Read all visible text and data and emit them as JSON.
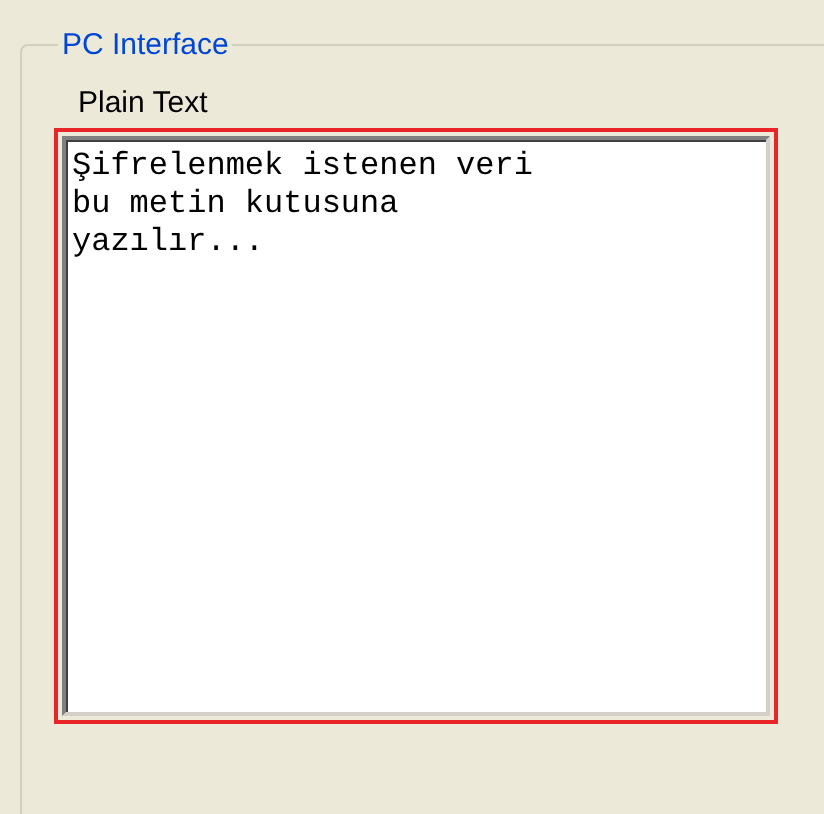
{
  "group": {
    "title": "PC Interface",
    "field": {
      "label": "Plain Text",
      "value": "Şifrelenmek istenen veri\nbu metin kutusuna\nyazılır..."
    }
  }
}
